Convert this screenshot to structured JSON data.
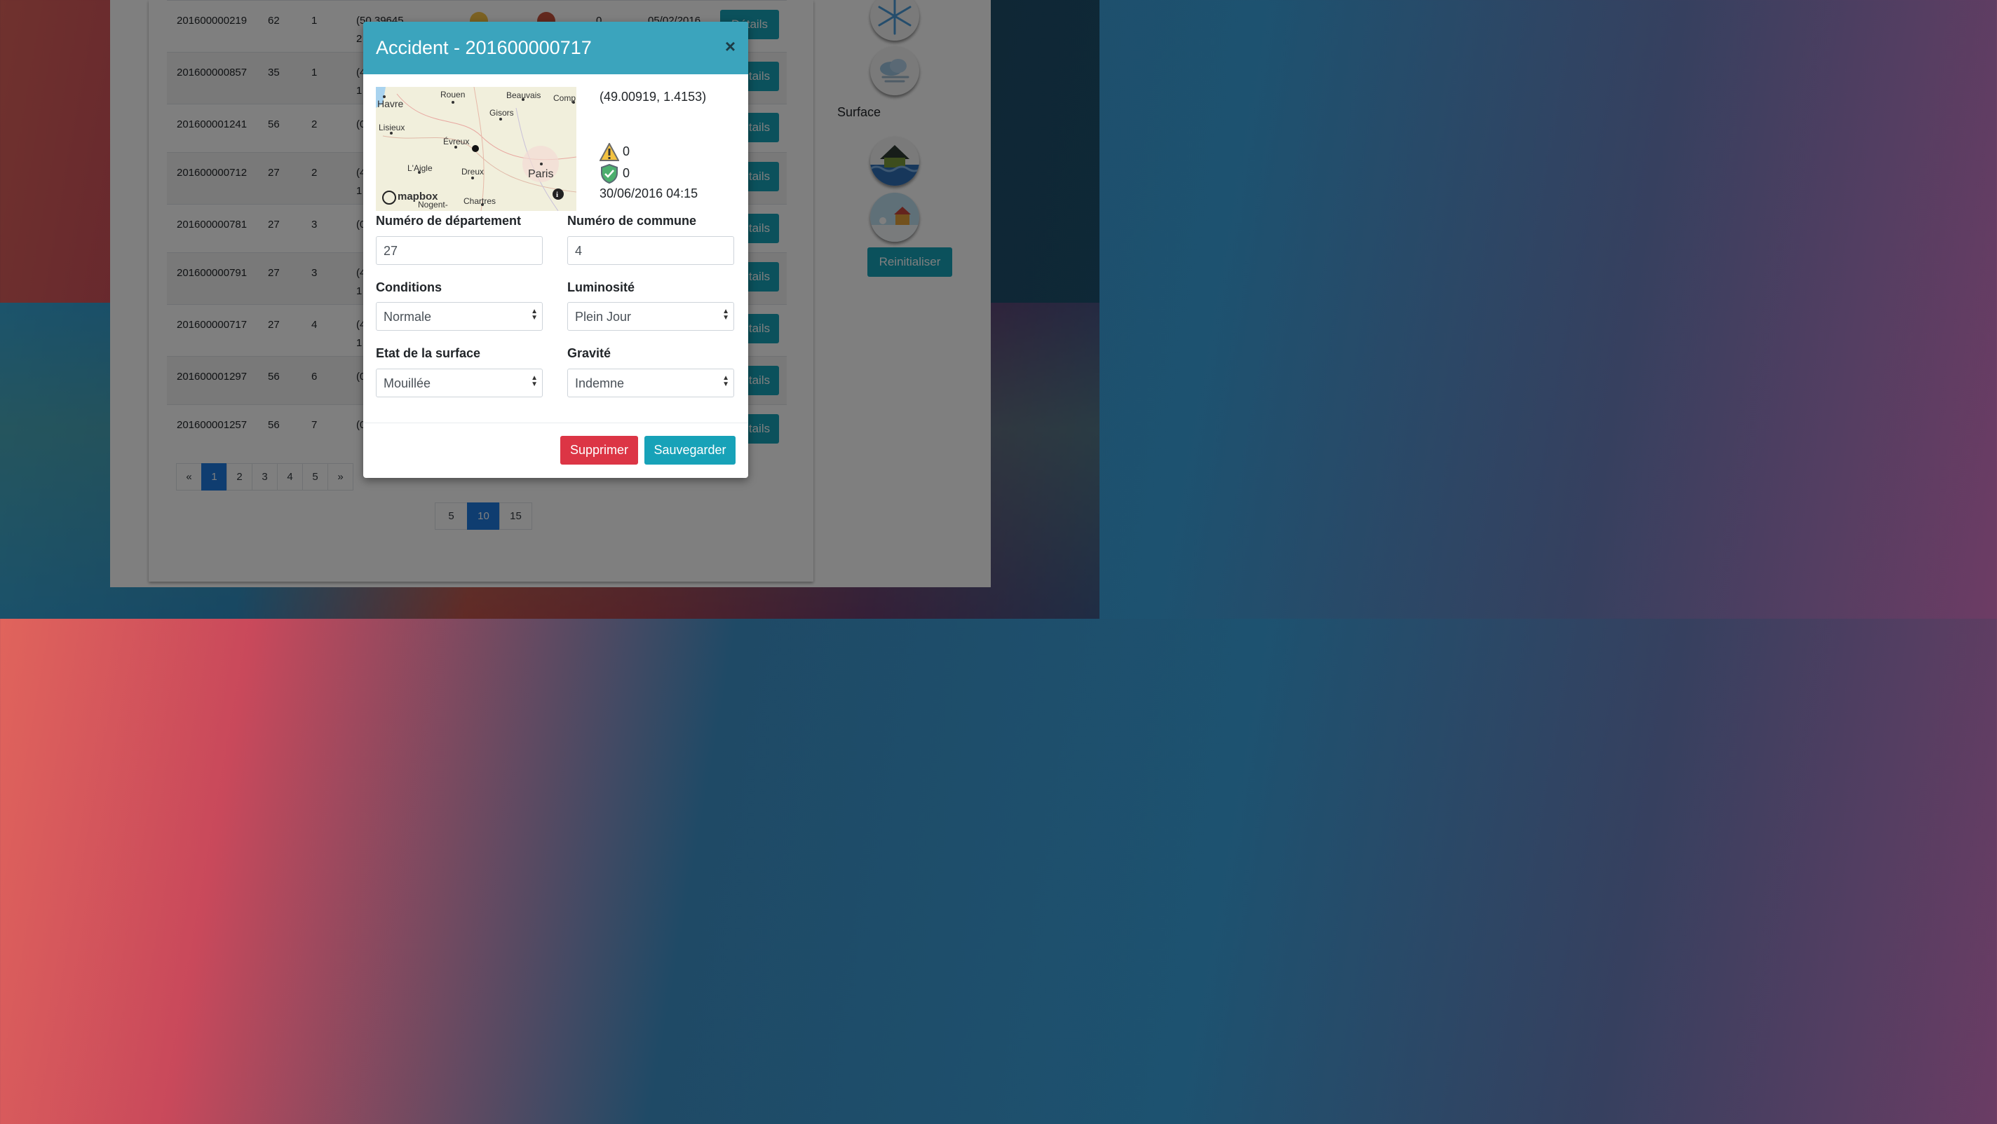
{
  "rows": [
    {
      "id": "201600000219",
      "dep": "62",
      "com": "1",
      "coord": "(50.39645,",
      "coord2": "2",
      "grav": "0",
      "date": "05/02/2016"
    },
    {
      "id": "201600000857",
      "dep": "35",
      "com": "1",
      "coord": "(4",
      "coord2": "1"
    },
    {
      "id": "201600001241",
      "dep": "56",
      "com": "2",
      "coord": "(0",
      "coord2": ""
    },
    {
      "id": "201600000712",
      "dep": "27",
      "com": "2",
      "coord": "(4",
      "coord2": "1"
    },
    {
      "id": "201600000781",
      "dep": "27",
      "com": "3",
      "coord": "(0",
      "coord2": ""
    },
    {
      "id": "201600000791",
      "dep": "27",
      "com": "3",
      "coord": "(4",
      "coord2": "1"
    },
    {
      "id": "201600000717",
      "dep": "27",
      "com": "4",
      "coord": "(4",
      "coord2": "1"
    },
    {
      "id": "201600001297",
      "dep": "56",
      "com": "6",
      "coord": "(0",
      "coord2": ""
    },
    {
      "id": "201600001257",
      "dep": "56",
      "com": "7",
      "coord": "(0",
      "coord2": ""
    }
  ],
  "details_label_first": "Détails",
  "details_label": "tails",
  "pagination": [
    "«",
    "1",
    "2",
    "3",
    "4",
    "5",
    "»"
  ],
  "page_sizes": [
    "5",
    "10",
    "15"
  ],
  "sidebar": {
    "surface_label": "Surface",
    "reset_label": "Reinitialiser"
  },
  "modal": {
    "title": "Accident - 201600000717",
    "close": "×",
    "coords": "(49.00919, 1.4153)",
    "warn_count": "0",
    "shield_count": "0",
    "datetime": "30/06/2016 04:15",
    "map_labels": [
      "Havre",
      "Rouen",
      "Beauvais",
      "Comp",
      "Gisors",
      "Lisieux",
      "Évreux",
      "L'Aigle",
      "Dreux",
      "Paris",
      "Nogent-",
      "Chartres",
      "mapbox"
    ],
    "fields": {
      "departement_label": "Numéro de département",
      "departement_value": "27",
      "commune_label": "Numéro de commune",
      "commune_value": "4",
      "conditions_label": "Conditions",
      "conditions_value": "Normale",
      "luminosite_label": "Luminosité",
      "luminosite_value": "Plein Jour",
      "surface_label": "Etat de la surface",
      "surface_value": "Mouillée",
      "gravite_label": "Gravité",
      "gravite_value": "Indemne"
    },
    "delete_label": "Supprimer",
    "save_label": "Sauvegarder"
  },
  "colors": {
    "accent": "#17a2b8",
    "header": "#3ba4bd",
    "danger": "#dc3545",
    "active_page": "#1f7ae0"
  }
}
